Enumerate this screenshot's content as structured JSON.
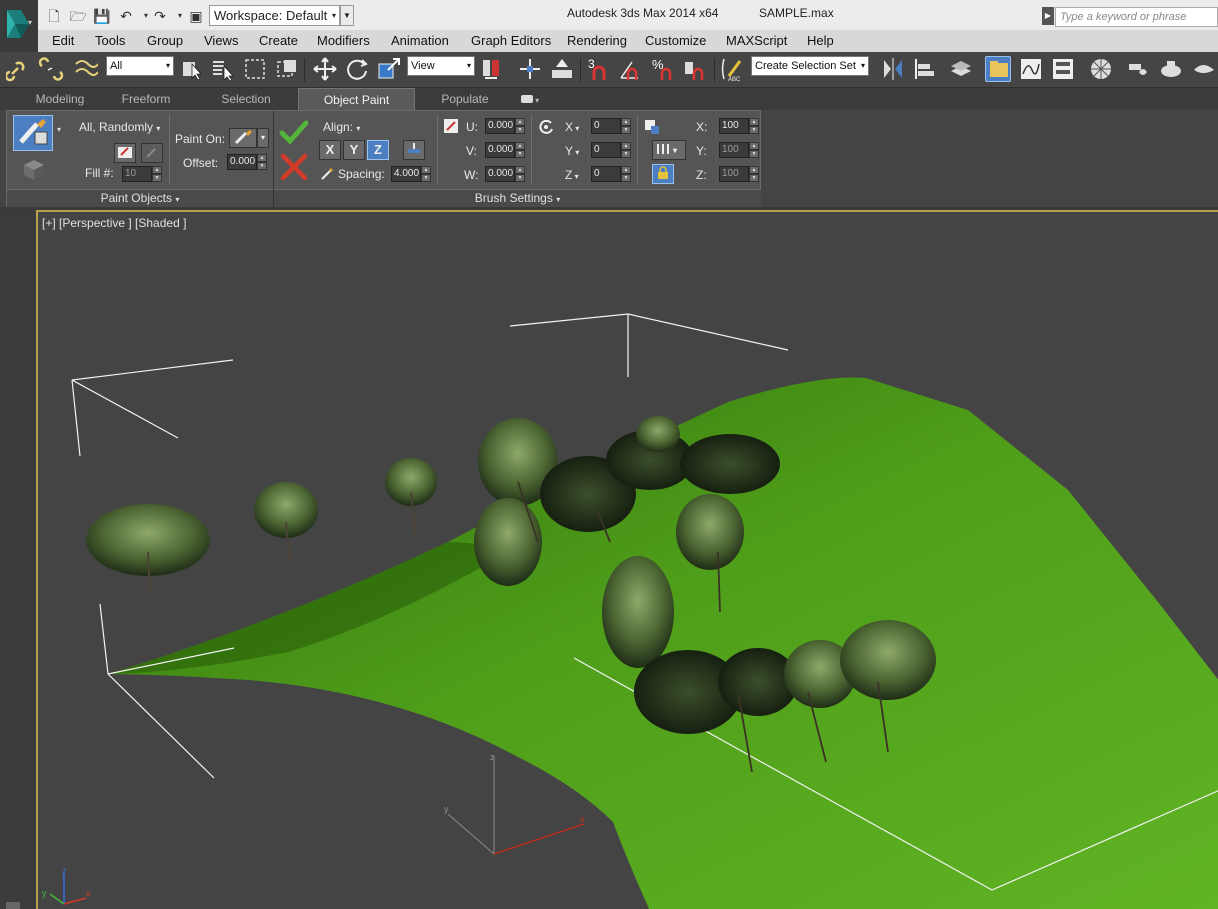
{
  "titlebar": {
    "workspace_label": "Workspace: Default",
    "app_title": "Autodesk 3ds Max  2014 x64",
    "file_title": "SAMPLE.max",
    "search_placeholder": "Type a keyword or phrase"
  },
  "menu": [
    "Edit",
    "Tools",
    "Group",
    "Views",
    "Create",
    "Modifiers",
    "Animation",
    "Graph Editors",
    "Rendering",
    "Customize",
    "MAXScript",
    "Help"
  ],
  "toolbar": {
    "filter_value": "All",
    "reference_coord": "View",
    "selection_set_placeholder": "Create Selection Set",
    "snap_3": "3",
    "snap_percent": "%"
  },
  "ribbon_tabs": [
    "Modeling",
    "Freeform",
    "Selection",
    "Object Paint",
    "Populate"
  ],
  "ribbon_selected_tab": "Object Paint",
  "paint_objects": {
    "mode": "All, Randomly",
    "fill_label": "Fill #:",
    "fill_value": "10",
    "paint_on_label": "Paint On:",
    "offset_label": "Offset:",
    "offset_value": "0.000",
    "footer": "Paint Objects"
  },
  "brush_settings": {
    "align_label": "Align:",
    "axis_x": "X",
    "axis_y": "Y",
    "axis_z": "Z",
    "spacing_label": "Spacing:",
    "spacing_value": "4.000",
    "u_label": "U:",
    "u_value": "0.000",
    "v_label": "V:",
    "v_value": "0.000",
    "w_label": "W:",
    "w_value": "0.000",
    "rx_label": "X",
    "rx_value": "0",
    "ry_label": "Y",
    "ry_value": "0",
    "rz_label": "Z",
    "rz_value": "0",
    "sx_label": "X:",
    "sx_value": "100",
    "sy_label": "Y:",
    "sy_value": "100",
    "sz_label": "Z:",
    "sz_value": "100",
    "footer": "Brush Settings"
  },
  "viewport": {
    "label": "[+] [Perspective ] [Shaded ]",
    "gizmo_axes": [
      "z",
      "y",
      "x"
    ],
    "terrain_color": "#4f9e1a"
  },
  "colors": {
    "accent_blue": "#4b7fc2",
    "viewport_border": "#b9a14a",
    "check_green": "#55b43c",
    "cancel_red": "#d23a2a"
  }
}
